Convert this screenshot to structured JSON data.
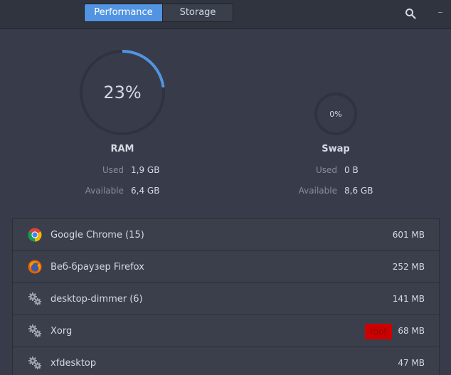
{
  "header": {
    "tabs": [
      {
        "label": "Performance",
        "active": true
      },
      {
        "label": "Storage",
        "active": false
      }
    ]
  },
  "ram": {
    "title": "RAM",
    "percent_text": "23%",
    "percent_value": 0.23,
    "used_label": "Used",
    "used_value": "1,9 GB",
    "available_label": "Available",
    "available_value": "6,4 GB"
  },
  "swap": {
    "title": "Swap",
    "percent_text": "0%",
    "percent_value": 0,
    "used_label": "Used",
    "used_value": "0 B",
    "available_label": "Available",
    "available_value": "8,6 GB"
  },
  "processes": [
    {
      "name": "Google Chrome (15)",
      "memory": "601 MB",
      "icon": "chrome-icon"
    },
    {
      "name": "Веб-браузер Firefox",
      "memory": "252 MB",
      "icon": "firefox-icon"
    },
    {
      "name": "desktop-dimmer (6)",
      "memory": "141 MB",
      "icon": "gears-icon"
    },
    {
      "name": "Xorg",
      "memory": "68 MB",
      "icon": "gears-icon",
      "badge": "root"
    },
    {
      "name": "xfdesktop",
      "memory": "47 MB",
      "icon": "gears-icon"
    }
  ],
  "colors": {
    "accent": "#5294e2",
    "background": "#383c4a",
    "root_badge": "#cc0000"
  }
}
